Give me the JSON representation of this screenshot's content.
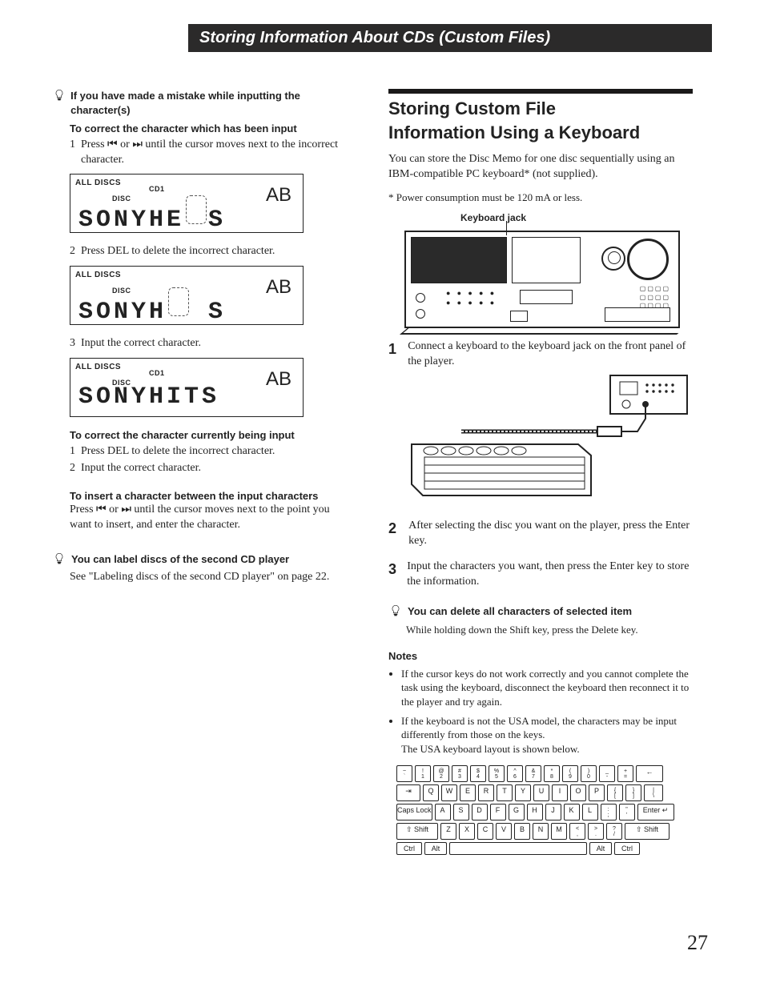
{
  "header": "Storing Information About CDs (Custom Files)",
  "left": {
    "tip1": "If you have made a mistake while inputting the character(s)",
    "correctInput_h": "To correct the character which has been input",
    "correctInput_s1": "Press ⏮ or ⏭ until the cursor moves next to the incorrect character.",
    "correctInput_s2": "Press DEL to delete the incorrect character.",
    "correctInput_s3": "Input the correct character.",
    "lcd": {
      "all": "ALL DISCS",
      "cd1": "CD1",
      "disc": "DISC",
      "ab": "AB",
      "t1": "SONYHE S",
      "t2": "SONYH  S",
      "t3": "SONYHITS"
    },
    "currently_h": "To correct the character currently being input",
    "currently_s1": "Press DEL to delete the incorrect character.",
    "currently_s2": "Input the correct character.",
    "insert_h": "To insert a character between the input characters",
    "insert_body": "Press ⏮ or ⏭ until the cursor moves next to the point you want to insert, and enter the character.",
    "tip2": "You can label discs of  the second CD player",
    "tip2_body": "See \"Labeling discs of the second CD player\" on page 22."
  },
  "right": {
    "title1": "Storing Custom File",
    "title2": "Information Using a Keyboard",
    "intro": "You can store the Disc Memo for one disc sequentially using an IBM-compatible PC keyboard* (not supplied).",
    "foot": "*  Power consumption must be 120 mA or less.",
    "kbd_label": "Keyboard jack",
    "step1": "Connect a keyboard to the keyboard jack on the front panel of the player.",
    "step2": "After selecting the disc you want on the player, press the Enter key.",
    "step3": "Input the characters you want, then press the Enter key to store the information.",
    "tip_del_h": "You can delete all characters of selected item",
    "tip_del_b": "While holding down the Shift key, press the Delete key.",
    "notes_h": "Notes",
    "note1": "If the cursor keys do not work correctly and you cannot complete the task using the keyboard, disconnect the keyboard then reconnect it to the player and try again.",
    "note2a": "If the keyboard is not the USA model, the characters may be input differently from those on the keys.",
    "note2b": "The USA keyboard layout is shown below.",
    "keys": {
      "row1": [
        "~ `",
        "! 1",
        "@ 2",
        "# 3",
        "$ 4",
        "% 5",
        "^ 6",
        "& 7",
        "* 8",
        "( 9",
        ") 0",
        "_ -",
        "+ =",
        "←"
      ],
      "row2": [
        "⇥",
        "Q",
        "W",
        "E",
        "R",
        "T",
        "Y",
        "U",
        "I",
        "O",
        "P",
        "{ [",
        "} ]",
        "| \\"
      ],
      "row3": [
        "Caps Lock",
        "A",
        "S",
        "D",
        "F",
        "G",
        "H",
        "J",
        "K",
        "L",
        ": ;",
        "\" '",
        "Enter ↵"
      ],
      "row4": [
        "⇧ Shift",
        "Z",
        "X",
        "C",
        "V",
        "B",
        "N",
        "M",
        "< ,",
        "> .",
        "? /",
        "⇧ Shift"
      ],
      "row5": [
        "Ctrl",
        "Alt",
        " ",
        "Alt",
        "Ctrl"
      ]
    }
  },
  "pageNum": "27"
}
